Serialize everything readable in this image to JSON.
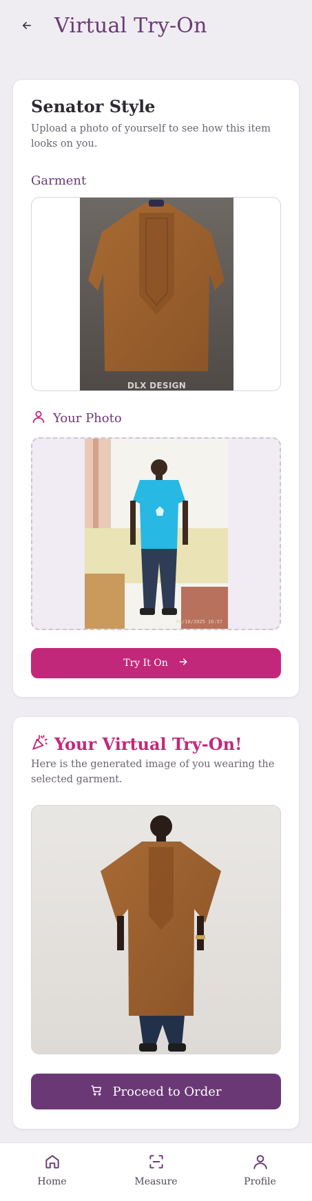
{
  "header": {
    "title": "Virtual Try-On",
    "back_icon": "arrow-left-icon"
  },
  "product": {
    "title": "Senator Style",
    "subtitle": "Upload a photo of yourself to see how this item looks on you."
  },
  "garment": {
    "label": "Garment",
    "image_caption": "DLX DESIGN"
  },
  "your_photo": {
    "label": "Your Photo",
    "icon": "user-icon",
    "timestamp": "06/10/2025 16:57"
  },
  "try_button": {
    "label": "Try It On",
    "icon": "arrow-right-icon"
  },
  "result": {
    "icon": "party-popper-icon",
    "title": "Your Virtual Try-On!",
    "subtitle": "Here is the generated image of you wearing the selected garment."
  },
  "order_button": {
    "label": "Proceed to Order",
    "icon": "cart-icon"
  },
  "bottom_nav": {
    "items": [
      {
        "label": "Home",
        "icon": "home-icon"
      },
      {
        "label": "Measure",
        "icon": "scan-icon"
      },
      {
        "label": "Profile",
        "icon": "user-icon"
      }
    ]
  },
  "colors": {
    "primary_purple": "#6b3876",
    "accent_pink": "#c2287a",
    "background": "#efedf2",
    "card": "#ffffff"
  }
}
